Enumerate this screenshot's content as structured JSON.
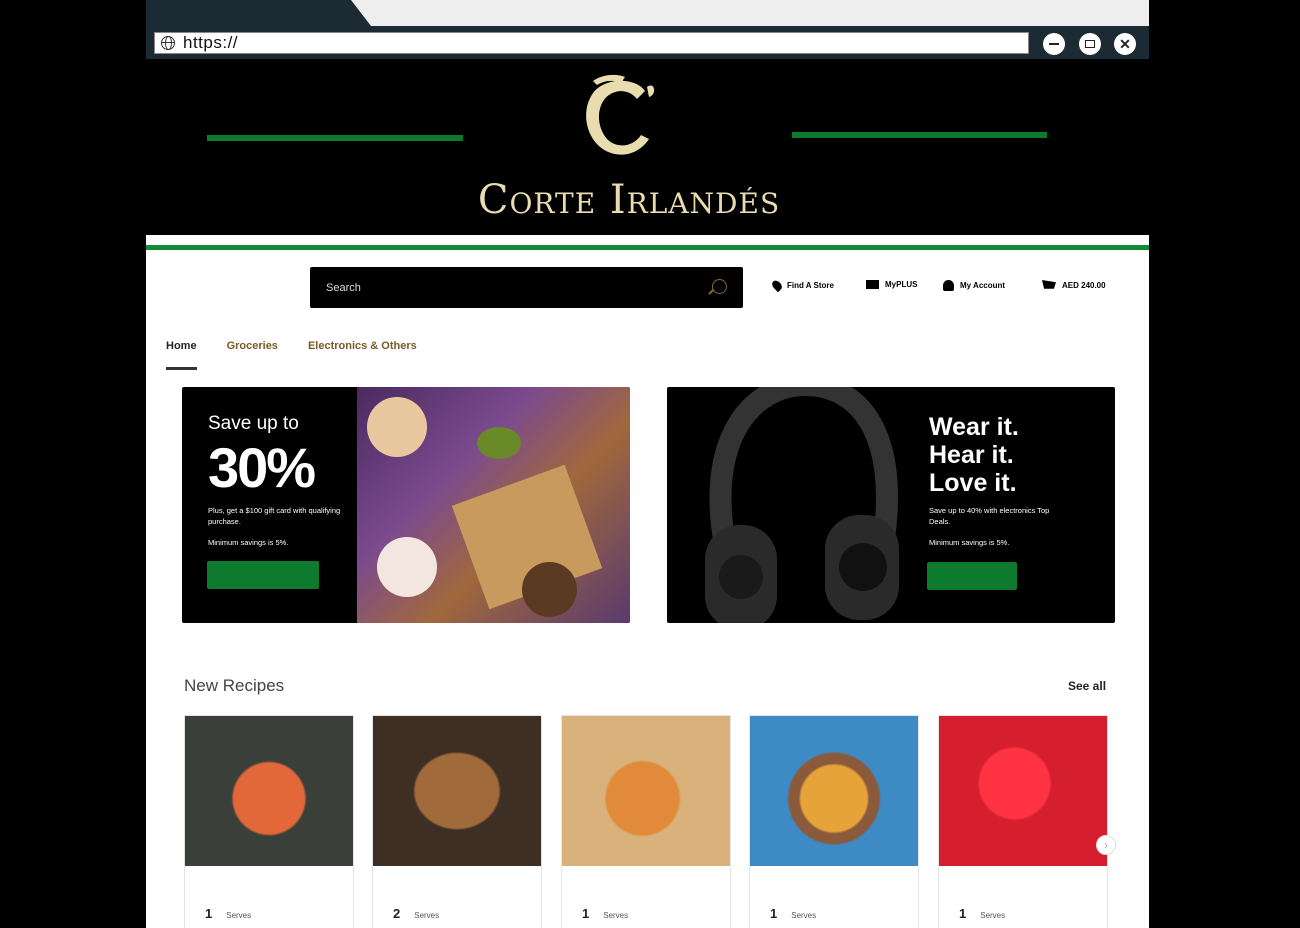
{
  "browser": {
    "url": "https://"
  },
  "brand": {
    "name": "Corte Irlandés",
    "logo_letter": "C"
  },
  "header": {
    "search_placeholder": "Search",
    "links": [
      "Find A Store",
      "MyPLUS",
      "My Account",
      "AED 240.00"
    ]
  },
  "nav": {
    "tabs": [
      "Home",
      "Groceries",
      "Electronics & Others"
    ]
  },
  "promos": {
    "left": {
      "line1": "Save up to",
      "big": "30%",
      "body": "Plus, get a $100 gift card with qualifying purchase.",
      "note": "Minimum savings is 5%."
    },
    "right": {
      "line1": "Wear it.",
      "line2": "Hear it.",
      "line3": "Love it.",
      "body": "Save up to 40% with electronics Top Deals.",
      "note": "Minimum savings is 5%."
    }
  },
  "recipes": {
    "title": "New Recipes",
    "see_all": "See all",
    "cards": [
      {
        "serves": "1",
        "label": "Serves",
        "color": "#3b3f3a"
      },
      {
        "serves": "2",
        "label": "Serves",
        "color": "#a06a3a"
      },
      {
        "serves": "1",
        "label": "Serves",
        "color": "#d8b27a"
      },
      {
        "serves": "1",
        "label": "Serves",
        "color": "#3d8ac4"
      },
      {
        "serves": "1",
        "label": "Serves",
        "color": "#d61f2e"
      }
    ]
  }
}
